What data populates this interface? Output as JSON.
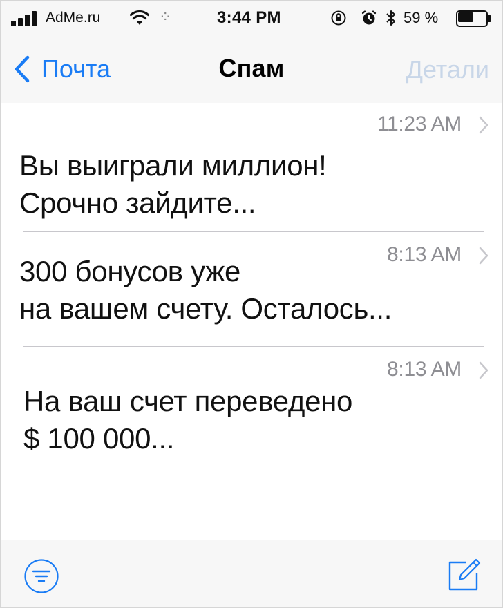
{
  "status_bar": {
    "carrier": "AdMe.ru",
    "time": "3:44 PM",
    "battery_percent_text": "59 %",
    "battery_level": 0.59,
    "icons": [
      "signal-icon",
      "wifi-icon",
      "activity-spinner-icon",
      "rotation-lock-icon",
      "alarm-icon",
      "bluetooth-icon",
      "battery-icon"
    ]
  },
  "nav": {
    "back_label": "Почта",
    "title": "Спам",
    "details_label": "Детали",
    "accent_color": "#1a7cf5",
    "disabled_color": "#c8d6e8"
  },
  "messages": [
    {
      "time": "11:23 AM",
      "line1": "Вы выиграли миллион!",
      "line2": "Срочно зайдите..."
    },
    {
      "time": "8:13 AM",
      "line1": "300 бонусов уже",
      "line2": "на вашем счету. Осталось..."
    },
    {
      "time": "8:13 AM",
      "line1": "На ваш счет переведено",
      "line2": "$ 100 000..."
    }
  ],
  "toolbar": {
    "left_icon": "filter-icon",
    "right_icon": "compose-icon"
  }
}
